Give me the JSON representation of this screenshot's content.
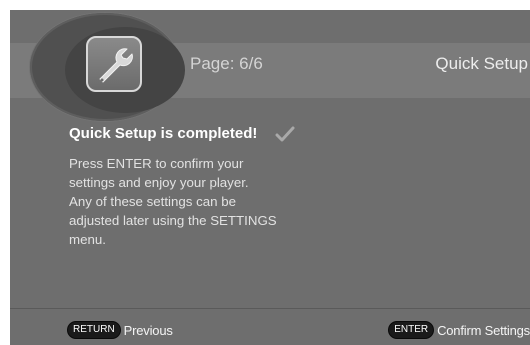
{
  "header": {
    "page_indicator": "Page: 6/6",
    "title": "Quick Setup",
    "icon": "wrench-icon"
  },
  "main": {
    "completion_title": "Quick Setup is completed!",
    "completion_icon": "checkmark-icon",
    "instruction_lines": [
      "Press ENTER to confirm your",
      "settings and enjoy your player.",
      "Any of these settings can be",
      "adjusted later using the SETTINGS",
      "menu."
    ]
  },
  "footer": {
    "return": {
      "key": "RETURN",
      "label": "Previous"
    },
    "enter": {
      "key": "ENTER",
      "label": "Confirm Settings"
    }
  },
  "colors": {
    "panel_background": "#6e6e6e",
    "header_band": "#7b7b7b",
    "key_pill": "#1a1a1a",
    "text_primary": "#ffffff"
  }
}
